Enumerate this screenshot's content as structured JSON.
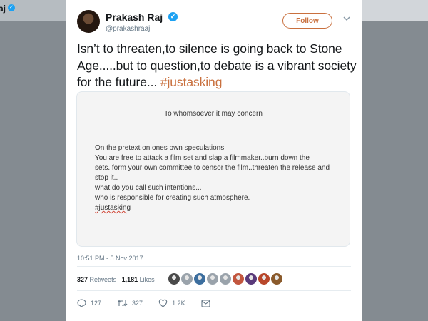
{
  "background": {
    "top_label": "aj"
  },
  "tweet": {
    "author": {
      "name": "Prakash Raj",
      "handle": "@prakashraaj"
    },
    "follow_label": "Follow",
    "text_main": "Isn’t to threaten,to silence is going back to Stone Age.....but to question,to debate is a vibrant society for the future...  ",
    "hashtag": "#justasking",
    "media": {
      "heading": "To whomsoever it may concern",
      "lines": [
        "On the pretext on ones own speculations",
        "You are free to attack a film set and slap a filmmaker..burn down the sets..form your own committee to censor the film..threaten the release and stop it..",
        "what do you call such intentions...",
        "who is responsible for creating such atmosphere."
      ],
      "tag": "#justasking"
    },
    "timestamp": "10:51 PM - 5 Nov 2017",
    "stats": {
      "retweets_count": "327",
      "retweets_label": "Retweets",
      "likes_count": "1,181",
      "likes_label": "Likes"
    },
    "actions": {
      "reply_count": "127",
      "retweet_count": "327",
      "like_count": "1.2K"
    }
  },
  "colors": {
    "accent": "#c9703e",
    "verified": "#1da1f2",
    "muted": "#657786",
    "page_bg": "#848b91"
  },
  "liker_avatars": [
    "#4a4a4a",
    "#9aa3ab",
    "#3c6e9e",
    "#9aa3ab",
    "#9aa3ab",
    "#c2563e",
    "#5a3a7a",
    "#b8472b",
    "#8a5a2b"
  ]
}
